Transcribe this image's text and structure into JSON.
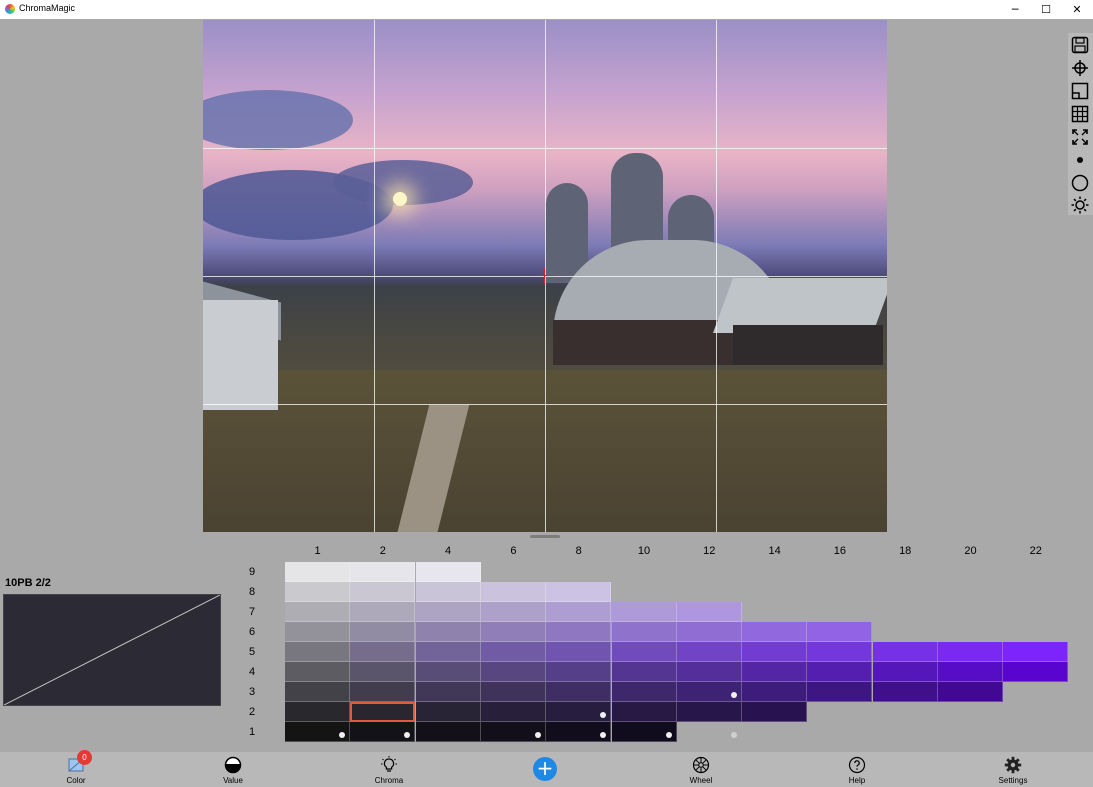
{
  "window": {
    "title": "ChromaMagic",
    "minimize_glyph": "─",
    "maximize_glyph": "☐",
    "close_glyph": "✕"
  },
  "color_notation": "10PB 2/2",
  "swatch_color": "#2b2a35",
  "chroma_columns": [
    "1",
    "2",
    "4",
    "6",
    "8",
    "10",
    "12",
    "14",
    "16",
    "18",
    "20",
    "22"
  ],
  "value_rows": [
    "9",
    "8",
    "7",
    "6",
    "5",
    "4",
    "3",
    "2",
    "1"
  ],
  "right_toolbar_icons": [
    "save-icon",
    "crosshair-icon",
    "frame-icon",
    "grid-icon",
    "fullscreen-icon",
    "dot-icon",
    "circle-icon",
    "brightness-icon"
  ],
  "bottom_nav": {
    "color": {
      "label": "Color",
      "badge": "0"
    },
    "value": {
      "label": "Value"
    },
    "chroma": {
      "label": "Chroma"
    },
    "add": {
      "glyph": "+"
    },
    "wheel": {
      "label": "Wheel"
    },
    "help": {
      "label": "Help"
    },
    "settings": {
      "label": "Settings"
    }
  },
  "selected_cell": {
    "value": "2",
    "chroma": "2"
  }
}
